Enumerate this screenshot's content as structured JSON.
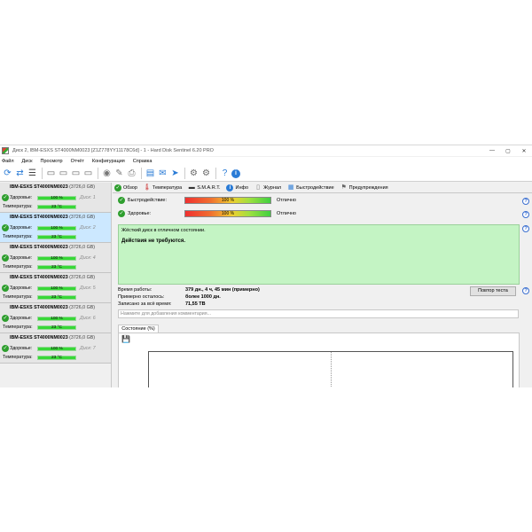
{
  "window": {
    "title": "Диск 2, IBM-ESXS ST4000NM0023 [Z1Z778YY11178C6d]  -  1  -  Hard Disk Sentinel 6.20 PRO",
    "controls": [
      "—",
      "▢",
      "✕"
    ]
  },
  "menu": [
    "Файл",
    "Диск",
    "Просмотр",
    "Отчёт",
    "Конфигурация",
    "Справка"
  ],
  "disks": [
    {
      "name": "IBM-ESXS ST4000NM0023",
      "capacity": "(3726,0 GB)",
      "tag": "Диск: 1",
      "health": "100 %",
      "health_pct": 100,
      "temp": "23 °C",
      "selected": false
    },
    {
      "name": "IBM-ESXS ST4000NM0023",
      "capacity": "(3726,0 GB)",
      "tag": "Диск: 2",
      "health": "100 %",
      "health_pct": 100,
      "temp": "23 °C",
      "selected": true
    },
    {
      "name": "IBM-ESXS ST4000NM0023",
      "capacity": "(3726,0 GB)",
      "tag": "Диск: 4",
      "health": "100 %",
      "health_pct": 100,
      "temp": "23 °C",
      "selected": false
    },
    {
      "name": "IBM-ESXS ST4000NM0023",
      "capacity": "(3726,0 GB)",
      "tag": "Диск: 5",
      "health": "100 %",
      "health_pct": 100,
      "temp": "23 °C",
      "selected": false
    },
    {
      "name": "IBM-ESXS ST4000NM0023",
      "capacity": "(3726,0 GB)",
      "tag": "Диск: 6",
      "health": "100 %",
      "health_pct": 100,
      "temp": "23 °C",
      "selected": false
    },
    {
      "name": "IBM-ESXS ST4000NM0023",
      "capacity": "(3726,0 GB)",
      "tag": "Диск: 7",
      "health": "100 %",
      "health_pct": 100,
      "temp": "23 °C",
      "selected": false
    }
  ],
  "labels": {
    "health": "Здоровье:",
    "temperature": "Температура:"
  },
  "tabs": [
    {
      "label": "Обзор",
      "icon": "check-icon"
    },
    {
      "label": "Температура",
      "icon": "thermometer-icon"
    },
    {
      "label": "S.M.A.R.T.",
      "icon": "smart-icon"
    },
    {
      "label": "Инфо",
      "icon": "info-icon"
    },
    {
      "label": "Журнал",
      "icon": "log-icon"
    },
    {
      "label": "Быстродействие",
      "icon": "performance-icon"
    },
    {
      "label": "Предупреждения",
      "icon": "warning-icon"
    }
  ],
  "overview": {
    "performance_label": "Быстродействие:",
    "performance_value": "100 %",
    "performance_pct": 100,
    "performance_status": "Отлично",
    "health_label": "Здоровье:",
    "health_value": "100 %",
    "health_pct": 100,
    "health_status": "Отлично",
    "message": "Жёсткий диск в отличном состоянии.",
    "action": "Действия не требуются.",
    "uptime_label": "Время работы:",
    "uptime_value": "379 дн., 4 ч, 45 мин (примерно)",
    "remaining_label": "Примерно осталось:",
    "remaining_value": "более 1000 дн.",
    "written_label": "Записано за всё время:",
    "written_value": "71,55 TB",
    "retest_button": "Повтор теста",
    "comment_placeholder": "Нажмите для добавления комментария...",
    "state_tab": "Состояние (%)"
  },
  "colors": {
    "health_bar": "#38d838",
    "status_bg": "#c4f4c4",
    "selected_row": "#cce8ff",
    "check": "#2e9e2e"
  }
}
